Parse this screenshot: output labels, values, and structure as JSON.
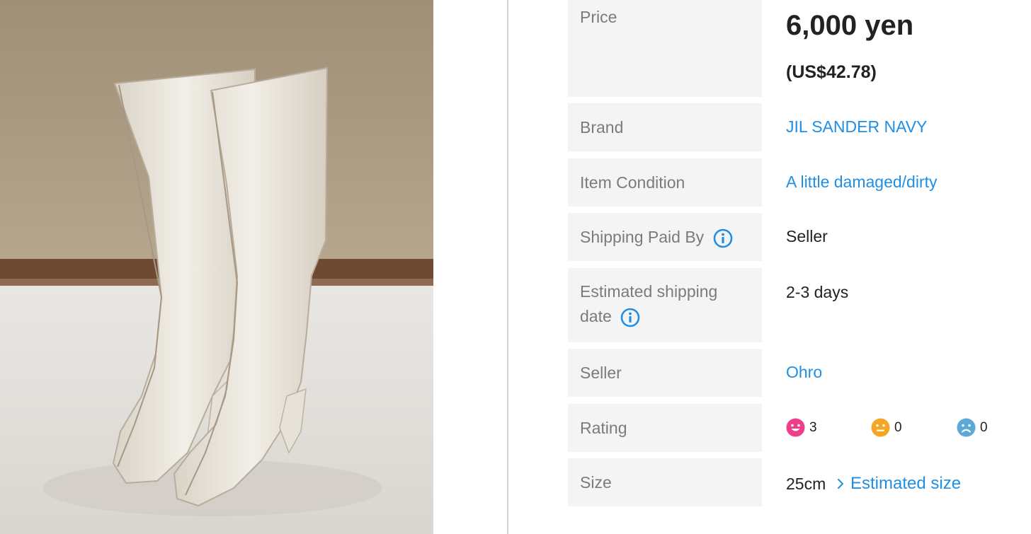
{
  "photo": {
    "icon": "product-photo-white-knee-high-boots"
  },
  "details": {
    "price": {
      "label": "Price",
      "value": "6,000 yen",
      "converted": "(US$42.78)"
    },
    "brand": {
      "label": "Brand",
      "value": "JIL SANDER NAVY"
    },
    "condition": {
      "label": "Item Condition",
      "value": "A little damaged/dirty"
    },
    "shipping_paid_by": {
      "label": "Shipping Paid By",
      "value": "Seller",
      "icon": "info-icon"
    },
    "shipping_date": {
      "label_line1": "Estimated shipping",
      "label_line2": "date",
      "value": "2-3 days",
      "icon": "info-icon"
    },
    "seller": {
      "label": "Seller",
      "value": "Ohro"
    },
    "rating": {
      "label": "Rating",
      "good": {
        "count": "3",
        "icon": "happy-face-icon",
        "color": "#ee3f8a"
      },
      "neutral": {
        "count": "0",
        "icon": "neutral-face-icon",
        "color": "#f5a623"
      },
      "bad": {
        "count": "0",
        "icon": "sad-face-icon",
        "color": "#5aa9d6"
      }
    },
    "size": {
      "label": "Size",
      "value": "25cm",
      "link": "Estimated size",
      "icon": "chevron-right-icon"
    }
  },
  "colors": {
    "link": "#1f8fe6",
    "label_bg": "#f4f4f4",
    "label_text": "#7b7b7b"
  }
}
